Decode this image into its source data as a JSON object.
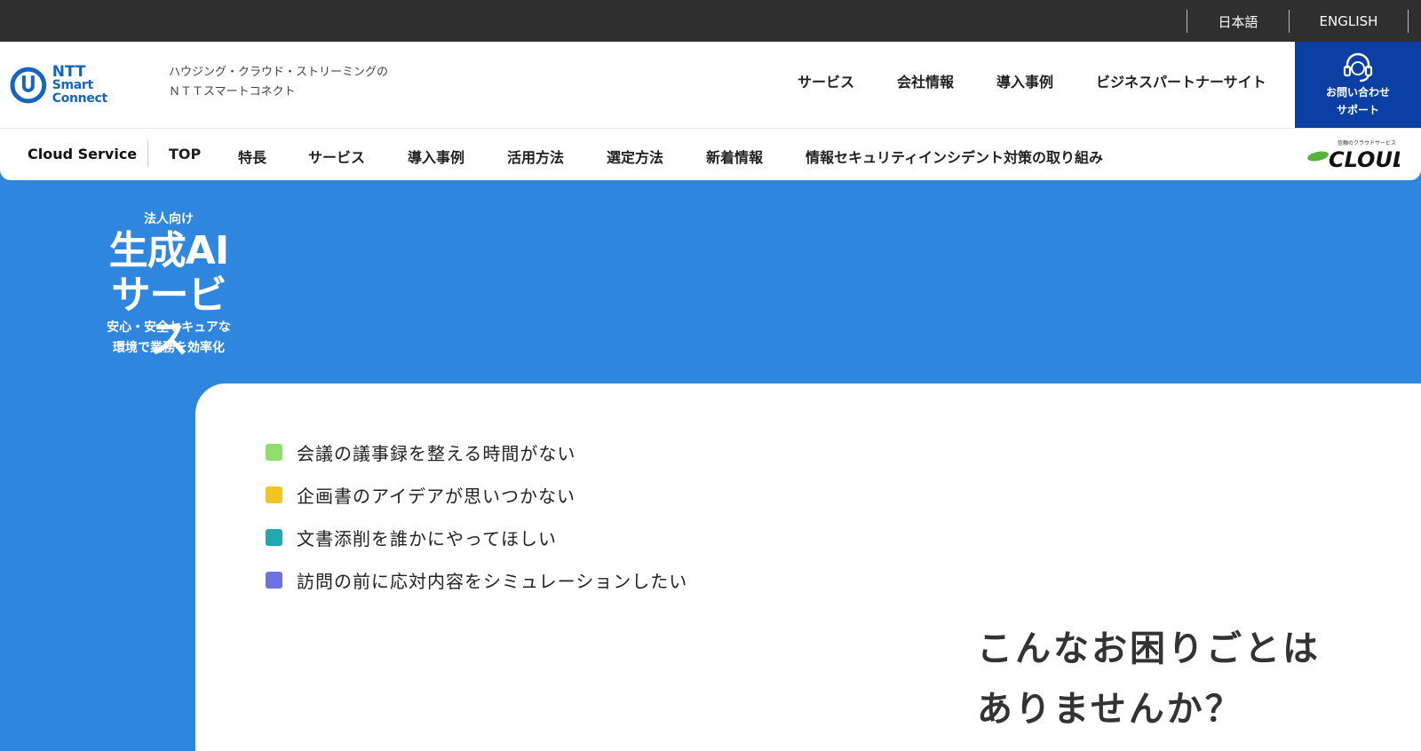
{
  "topbar": {
    "lang_ja": "日本語",
    "lang_en": "ENGLISH"
  },
  "header": {
    "logo_line1": "NTT",
    "logo_line2": "Smart Connect",
    "tagline_line1": "ハウジング・クラウド・ストリーミングの",
    "tagline_line2": "ＮＴＴスマートコネクト",
    "nav": [
      "サービス",
      "会社情報",
      "導入事例",
      "ビジネスパートナーサイト"
    ],
    "contact_line1": "お問い合わせ",
    "contact_line2": "サポート"
  },
  "subnav": {
    "title": "Cloud Service",
    "items": [
      "TOP",
      "特長",
      "サービス",
      "導入事例",
      "活用方法",
      "選定方法",
      "新着情報",
      "情報セキュリティインシデント対策の取り組み"
    ],
    "cloud_logo_small": "信頼のクラウドサービス",
    "cloud_logo_main": "CLOUD"
  },
  "hero": {
    "small": "法人向け",
    "title_line1": "生成AI",
    "title_line2": "サービス",
    "sub_line1": "安心・安全セキュアな",
    "sub_line2": "環境で業務を効率化"
  },
  "problems": [
    {
      "text": "会議の議事録を整える時間がない",
      "color": "#8ee06a"
    },
    {
      "text": "企画書のアイデアが思いつかない",
      "color": "#f2c523"
    },
    {
      "text": "文書添削を誰かにやってほしい",
      "color": "#22a8b0"
    },
    {
      "text": "訪問の前に応対内容をシミュレーションしたい",
      "color": "#6e72e0"
    }
  ],
  "question": {
    "line1": "こんなお困りごとは",
    "line2": "ありませんか？"
  },
  "colors": {
    "topbar": "#2f2f2f",
    "hero_bg": "#2e86de",
    "contact_bg": "#0b3fa3",
    "brand_blue": "#1565c0"
  }
}
